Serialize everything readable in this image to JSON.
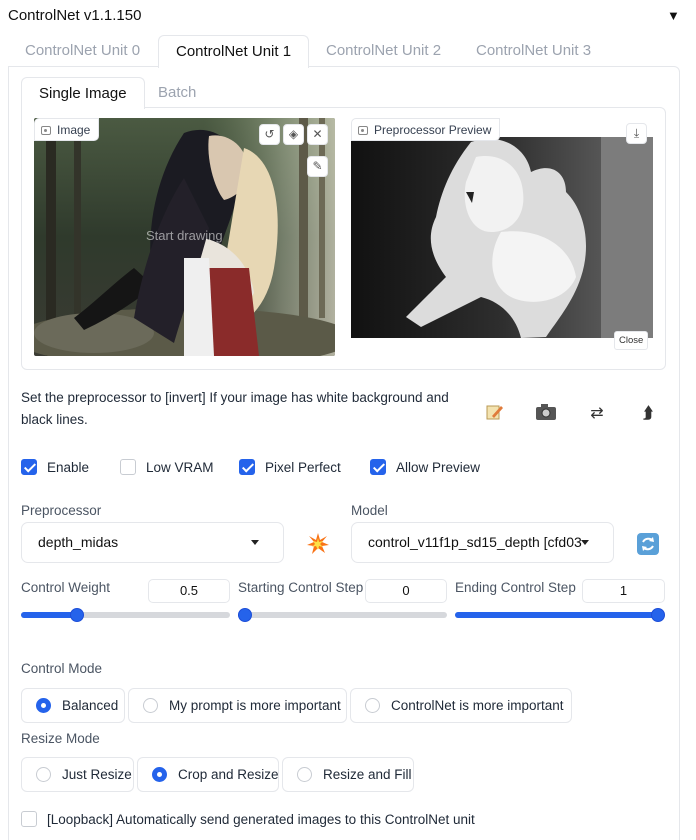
{
  "header": {
    "title": "ControlNet v1.1.150",
    "collapse_icon": "triangle-down-icon"
  },
  "unit_tabs": [
    {
      "label": "ControlNet Unit 0",
      "active": false
    },
    {
      "label": "ControlNet Unit 1",
      "active": true
    },
    {
      "label": "ControlNet Unit 2",
      "active": false
    },
    {
      "label": "ControlNet Unit 3",
      "active": false
    }
  ],
  "image_tabs": [
    {
      "label": "Single Image",
      "active": true
    },
    {
      "label": "Batch",
      "active": false
    }
  ],
  "image_input": {
    "label": "Image",
    "overlay_text": "Start drawing",
    "buttons": [
      "undo-icon",
      "eraser-icon",
      "close-icon",
      "brush-icon"
    ]
  },
  "preview": {
    "label": "Preprocessor Preview",
    "download_icon": "download-icon",
    "close_label": "Close"
  },
  "note": "Set the preprocessor to [invert] If your image has white background and black lines.",
  "tool_icons": [
    "edit-icon",
    "camera-icon",
    "swap-icon",
    "upload-arrow-icon"
  ],
  "checkboxes": [
    {
      "label": "Enable",
      "checked": true
    },
    {
      "label": "Low VRAM",
      "checked": false
    },
    {
      "label": "Pixel Perfect",
      "checked": true
    },
    {
      "label": "Allow Preview",
      "checked": true
    }
  ],
  "preprocessor": {
    "label": "Preprocessor",
    "value": "depth_midas",
    "run_icon": "explosion-icon"
  },
  "model": {
    "label": "Model",
    "value": "control_v11f1p_sd15_depth [cfd03",
    "refresh_icon": "refresh-icon"
  },
  "sliders": [
    {
      "label": "Control Weight",
      "value": "0.5",
      "fraction": 0.25
    },
    {
      "label": "Starting Control Step",
      "value": "0",
      "fraction": 0.0
    },
    {
      "label": "Ending Control Step",
      "value": "1",
      "fraction": 1.0
    }
  ],
  "control_mode": {
    "label": "Control Mode",
    "options": [
      "Balanced",
      "My prompt is more important",
      "ControlNet is more important"
    ],
    "selected": "Balanced"
  },
  "resize_mode": {
    "label": "Resize Mode",
    "options": [
      "Just Resize",
      "Crop and Resize",
      "Resize and Fill"
    ],
    "selected": "Crop and Resize"
  },
  "loopback": {
    "label": "[Loopback] Automatically send generated images to this ControlNet unit",
    "checked": false
  },
  "colors": {
    "accent": "#2563eb",
    "border": "#e5e7eb",
    "muted": "#9ca3af"
  }
}
